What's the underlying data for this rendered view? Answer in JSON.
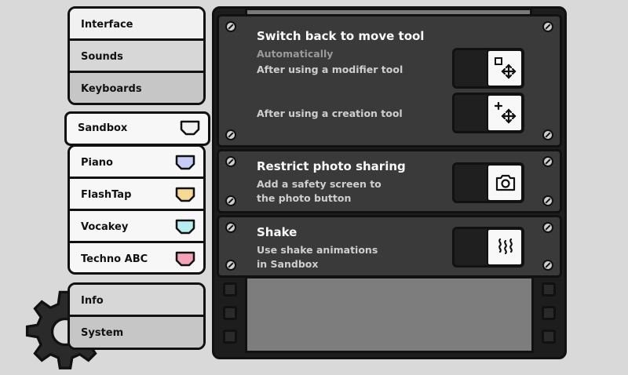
{
  "nav_group_1": {
    "items": [
      {
        "label": "Interface"
      },
      {
        "label": "Sounds"
      },
      {
        "label": "Keyboards"
      }
    ]
  },
  "nav_group_2": {
    "items": [
      {
        "label": "Sandbox",
        "tag_color": "#f2f2f2"
      },
      {
        "label": "Piano",
        "tag_color": "#c8cdf7"
      },
      {
        "label": "FlashTap",
        "tag_color": "#f7d996"
      },
      {
        "label": "Vocakey",
        "tag_color": "#b8eef0"
      },
      {
        "label": "Techno ABC",
        "tag_color": "#f4a2b8"
      }
    ]
  },
  "nav_group_3": {
    "items": [
      {
        "label": "Info"
      },
      {
        "label": "System"
      }
    ]
  },
  "settings": {
    "switch_back": {
      "title": "Switch back to move tool",
      "subtitle": "Automatically",
      "option_modifier": "After using a modifier tool",
      "option_creation": "After using a creation tool"
    },
    "restrict_photo": {
      "title": "Restrict photo sharing",
      "line1": "Add a safety screen to",
      "line2": "the photo button"
    },
    "shake": {
      "title": "Shake",
      "line1": "Use shake animations",
      "line2": "in Sandbox"
    }
  },
  "icons": [
    "gear-icon",
    "tag-icon",
    "modifier-move-icon",
    "creation-move-icon",
    "camera-icon",
    "shake-icon",
    "screw-icon"
  ]
}
